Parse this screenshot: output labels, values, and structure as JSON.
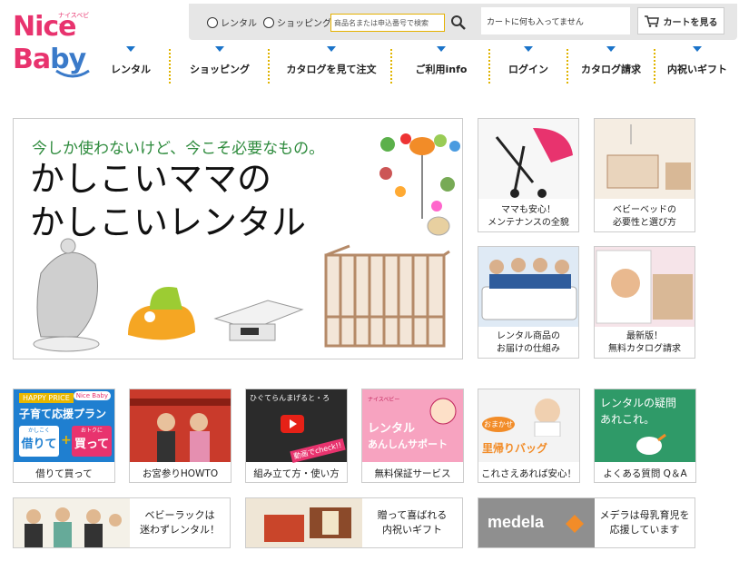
{
  "logo": {
    "line1": "Nice",
    "line2a": "Ba",
    "line2b": "by",
    "kana": "ナイスベビー"
  },
  "topbar": {
    "radio_rental": "レンタル",
    "radio_shopping": "ショッピング",
    "search_placeholder": "商品名または申込番号で検索",
    "cart_message": "カートに何も入ってません",
    "cart_button": "カートを見る"
  },
  "nav": [
    {
      "label": "レンタル"
    },
    {
      "label": "ショッピング"
    },
    {
      "label": "カタログを見て注文"
    },
    {
      "label": "ご利用info"
    },
    {
      "label": "ログイン"
    },
    {
      "label": "カタログ請求"
    },
    {
      "label": "内祝いギフト"
    }
  ],
  "hero": {
    "tagline": "今しか使わないけど、今こそ必要なもの。",
    "headline1": "かしこいママの",
    "headline2": "かしこいレンタル"
  },
  "side_tiles": [
    {
      "line1": "ママも安心！",
      "line2": "メンテナンスの全貌"
    },
    {
      "line1": "ベビーベッドの",
      "line2": "必要性と選び方"
    },
    {
      "line1": "レンタル商品の",
      "line2": "お届けの仕組み"
    },
    {
      "line1": "最新版！",
      "line2": "無料カタログ請求"
    }
  ],
  "banner_texts": {
    "happy_price": "HAPPY PRICE",
    "plan": "子育て応援プラン",
    "rent": "借りて",
    "buy": "買って",
    "rent_sub": "かしこく",
    "buy_sub": "おトクに",
    "video_title": "ひぐてらんまげると・ろ",
    "video_badge": "動画でcheck!!",
    "support_kana": "ナイスベビー",
    "support1": "レンタル",
    "support2": "あんしんサポート",
    "omakase": "おまかせ",
    "satogaeri": "里帰りバッグ",
    "faq1": "レンタルの疑問",
    "faq2": "あれこれ。",
    "medela": "medela",
    "nicebaby_small": "Nice Baby"
  },
  "bottom_tiles": [
    {
      "caption": "借りて買って"
    },
    {
      "caption": "お宮参りHOWTO"
    },
    {
      "caption": "組み立て方・使い方"
    },
    {
      "caption": "無料保証サービス"
    },
    {
      "caption": "これさえあれば安心！"
    },
    {
      "caption": "よくある質問 Q＆A"
    }
  ],
  "wide_tiles": [
    {
      "caption": "ベビーラックは\n迷わずレンタル！"
    },
    {
      "caption": "贈って喜ばれる\n内祝いギフト"
    },
    {
      "caption": "メデラは母乳育児を\n応援しています"
    }
  ],
  "colors": {
    "brand_pink": "#e8336e",
    "brand_blue": "#3a7ac9",
    "nav_triangle": "#1a73c9",
    "nav_divider": "#e0b400",
    "tagline_green": "#2e8b3d"
  }
}
